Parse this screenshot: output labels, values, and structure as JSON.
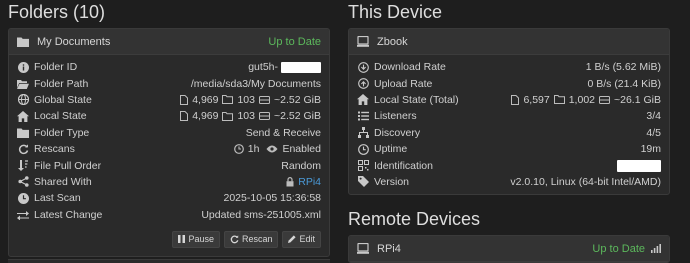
{
  "folders": {
    "title": "Folders (10)",
    "panel": {
      "name": "My Documents",
      "status": "Up to Date",
      "rows": {
        "folder_id": {
          "label": "Folder ID",
          "value": "gut5h-"
        },
        "folder_path": {
          "label": "Folder Path",
          "value": "/media/sda3/My Documents"
        },
        "global_state": {
          "label": "Global State",
          "files": "4,969",
          "dirs": "103",
          "size": "~2.52 GiB"
        },
        "local_state": {
          "label": "Local State",
          "files": "4,969",
          "dirs": "103",
          "size": "~2.52 GiB"
        },
        "folder_type": {
          "label": "Folder Type",
          "value": "Send & Receive"
        },
        "rescans": {
          "label": "Rescans",
          "interval": "1h",
          "watcher": "Enabled"
        },
        "pull_order": {
          "label": "File Pull Order",
          "value": "Random"
        },
        "shared_with": {
          "label": "Shared With",
          "value": "RPi4"
        },
        "last_scan": {
          "label": "Last Scan",
          "value": "2025-10-05 15:36:58"
        },
        "latest_change": {
          "label": "Latest Change",
          "value": "Updated sms-251005.xml"
        }
      },
      "buttons": {
        "pause": "Pause",
        "rescan": "Rescan",
        "edit": "Edit"
      }
    }
  },
  "device": {
    "title": "This Device",
    "panel": {
      "name": "Zbook",
      "rows": {
        "download_rate": {
          "label": "Download Rate",
          "value": "1 B/s (5.62 MiB)"
        },
        "upload_rate": {
          "label": "Upload Rate",
          "value": "0 B/s (21.4 KiB)"
        },
        "local_state": {
          "label": "Local State (Total)",
          "files": "6,597",
          "dirs": "1,002",
          "size": "~26.1 GiB"
        },
        "listeners": {
          "label": "Listeners",
          "value": "3/4"
        },
        "discovery": {
          "label": "Discovery",
          "value": "4/5"
        },
        "uptime": {
          "label": "Uptime",
          "value": "19m"
        },
        "identification": {
          "label": "Identification"
        },
        "version": {
          "label": "Version",
          "value": "v2.0.10, Linux (64-bit Intel/AMD)"
        }
      }
    }
  },
  "remote": {
    "title": "Remote Devices",
    "device": {
      "name": "RPi4",
      "status": "Up to Date"
    }
  },
  "colors": {
    "accent_green": "#5cb85c",
    "link_blue": "#4a9ad8",
    "background": "#1e1e1e",
    "panel": "#2a2a2a"
  }
}
